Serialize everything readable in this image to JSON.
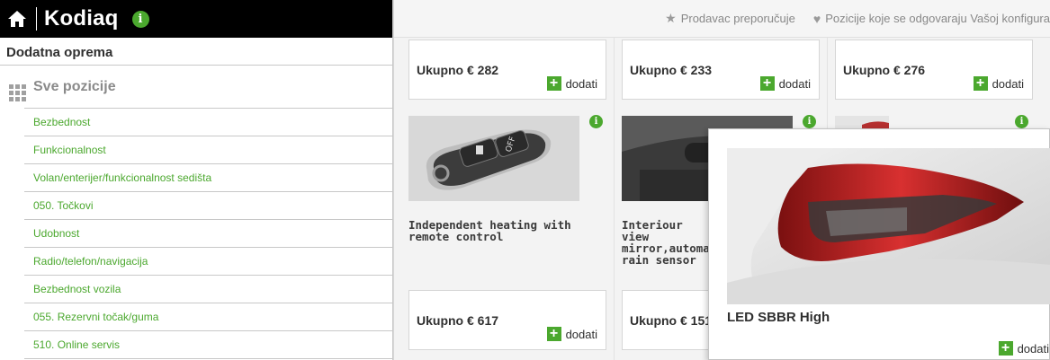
{
  "header": {
    "title": "Kodiaq"
  },
  "sidebar": {
    "section_title": "Dodatna oprema",
    "all_label": "Sve pozicije",
    "items": [
      {
        "label": "Bezbednost"
      },
      {
        "label": "Funkcionalnost"
      },
      {
        "label": "Volan/enterijer/funkcionalnost sedišta"
      },
      {
        "label": "050. Točkovi"
      },
      {
        "label": "Udobnost"
      },
      {
        "label": "Radio/telefon/navigacija"
      },
      {
        "label": "Bezbednost vozila"
      },
      {
        "label": "055. Rezervni točak/guma"
      },
      {
        "label": "510. Online servis"
      }
    ]
  },
  "filters": {
    "dealer_label": "Prodavac preporučuje",
    "match_label": "Pozicije koje se odgovaraju Vašoj konfigura"
  },
  "products": {
    "top": [
      {
        "price": "Ukupno € 282",
        "add": "dodati"
      },
      {
        "price": "Ukupno € 233",
        "add": "dodati"
      },
      {
        "price": "Ukupno € 276",
        "add": "dodati"
      }
    ],
    "middle": [
      {
        "title": "Independent heating with remote control",
        "price": "Ukupno € 617",
        "add": "dodati"
      },
      {
        "title": "Interiour view mirror,automa rain sensor",
        "price": "Ukupno € 151"
      }
    ]
  },
  "popup": {
    "title": "LED SBBR High",
    "add": "dodati"
  },
  "colors": {
    "accent": "#4ba82e",
    "topbar": "#000000"
  },
  "icons": [
    "home-icon",
    "info-icon",
    "grid-icon",
    "star-icon",
    "heart-icon",
    "plus-icon"
  ]
}
